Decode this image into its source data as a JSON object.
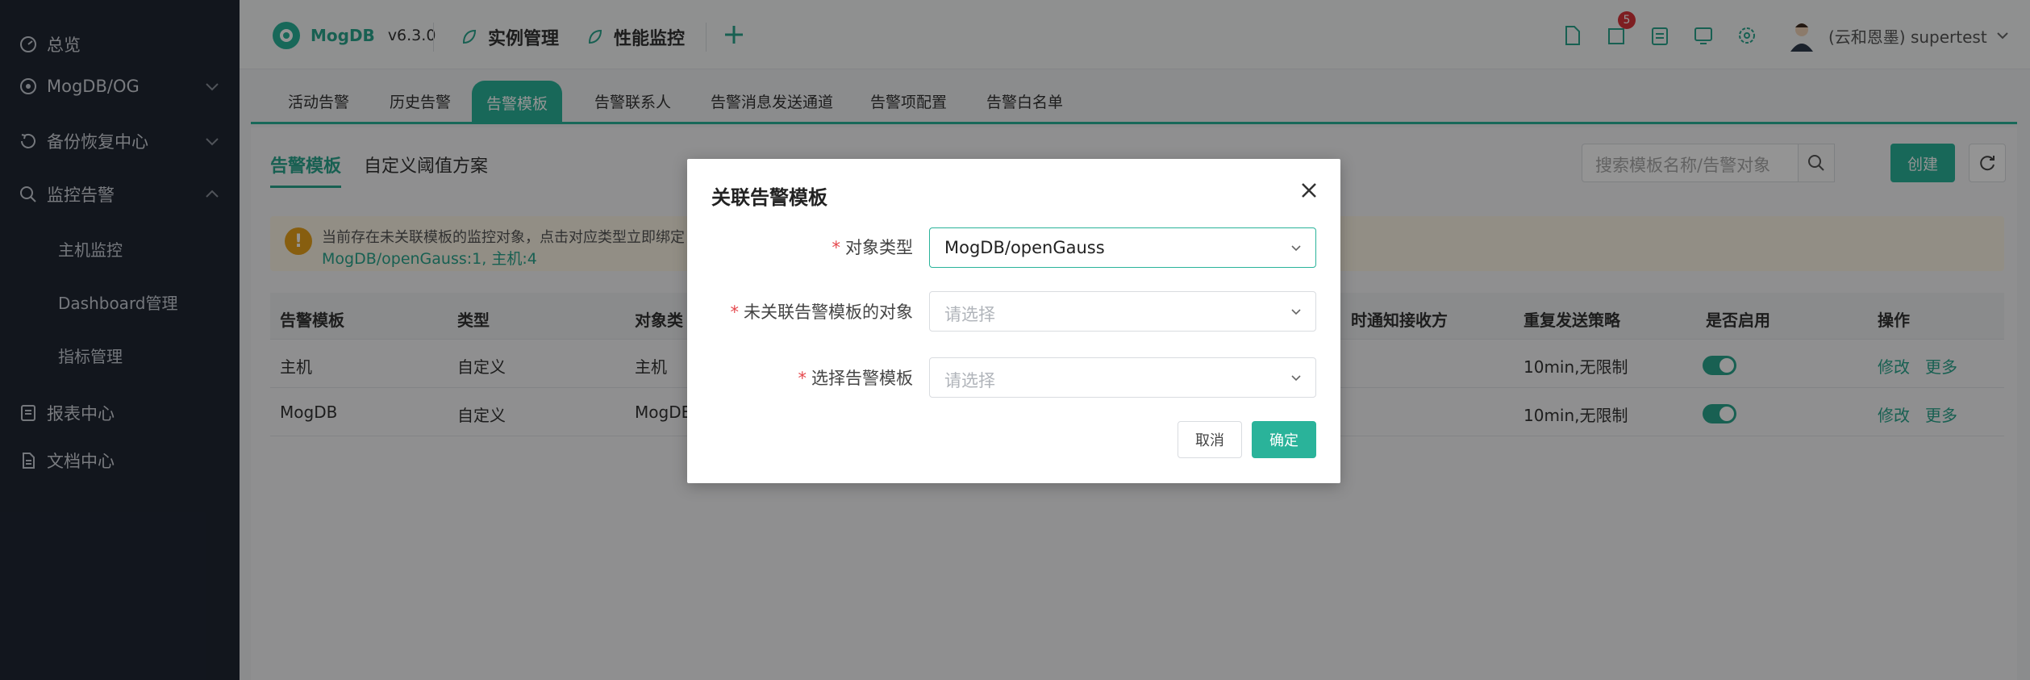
{
  "sidebar": {
    "items": [
      {
        "label": "总览"
      },
      {
        "label": "MogDB/OG"
      },
      {
        "label": "备份恢复中心"
      },
      {
        "label": "监控告警"
      },
      {
        "label": "报表中心"
      },
      {
        "label": "文档中心"
      }
    ],
    "sub_items": [
      {
        "label": "主机监控"
      },
      {
        "label": "Dashboard管理"
      },
      {
        "label": "指标管理"
      }
    ]
  },
  "topbar": {
    "logo_text": "MogDB",
    "version": "v6.3.0",
    "nav": [
      {
        "label": "实例管理"
      },
      {
        "label": "性能监控"
      }
    ],
    "badge_count": "5",
    "user": "(云和恩墨) supertest"
  },
  "tabs": [
    {
      "label": "活动告警"
    },
    {
      "label": "历史告警"
    },
    {
      "label": "告警模板"
    },
    {
      "label": "告警联系人"
    },
    {
      "label": "告警消息发送通道"
    },
    {
      "label": "告警项配置"
    },
    {
      "label": "告警白名单"
    }
  ],
  "subtabs": [
    {
      "label": "告警模板"
    },
    {
      "label": "自定义阈值方案"
    }
  ],
  "search": {
    "placeholder": "搜索模板名称/告警对象"
  },
  "create_label": "创建",
  "alert": {
    "text": "当前存在未关联模板的监控对象，点击对应类型立即绑定",
    "link": "MogDB/openGauss:1, 主机:4"
  },
  "table": {
    "headers": [
      "告警模板",
      "类型",
      "对象类",
      "时通知接收方",
      "重复发送策略",
      "是否启用",
      "操作"
    ],
    "rows": [
      {
        "template": "主机",
        "type": "自定义",
        "obj": "主机",
        "repeat": "10min,无限制",
        "edit": "修改",
        "more": "更多"
      },
      {
        "template": "MogDB",
        "type": "自定义",
        "obj": "MogDE",
        "repeat": "10min,无限制",
        "edit": "修改",
        "more": "更多"
      }
    ]
  },
  "modal": {
    "title": "关联告警模板",
    "fields": [
      {
        "label": "对象类型",
        "value": "MogDB/openGauss",
        "placeholder": ""
      },
      {
        "label": "未关联告警模板的对象",
        "value": "",
        "placeholder": "请选择"
      },
      {
        "label": "选择告警模板",
        "value": "",
        "placeholder": "请选择"
      }
    ],
    "required_mark": "*",
    "cancel": "取消",
    "confirm": "确定"
  },
  "colors": {
    "accent": "#2ab39a",
    "sidebar_bg": "#1f2633",
    "badge": "#d9343a",
    "warning": "#e8a21b"
  }
}
